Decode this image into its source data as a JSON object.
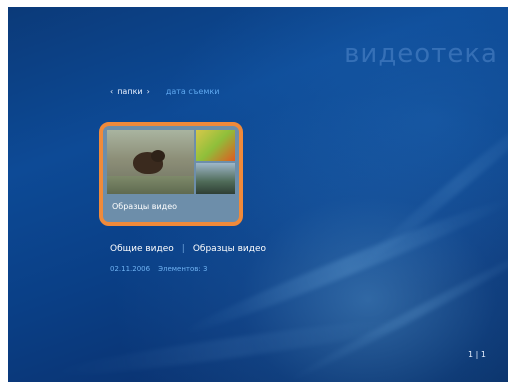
{
  "page_title": "видеотека",
  "nav": {
    "folders_label": "папки",
    "date_label": "дата съемки"
  },
  "tile": {
    "label": "Образцы видео"
  },
  "info": {
    "primary": "Общие видео",
    "secondary": "Образцы видео",
    "date": "02.11.2006",
    "count_text": "Элементов: 3"
  },
  "pager": "1 | 1"
}
